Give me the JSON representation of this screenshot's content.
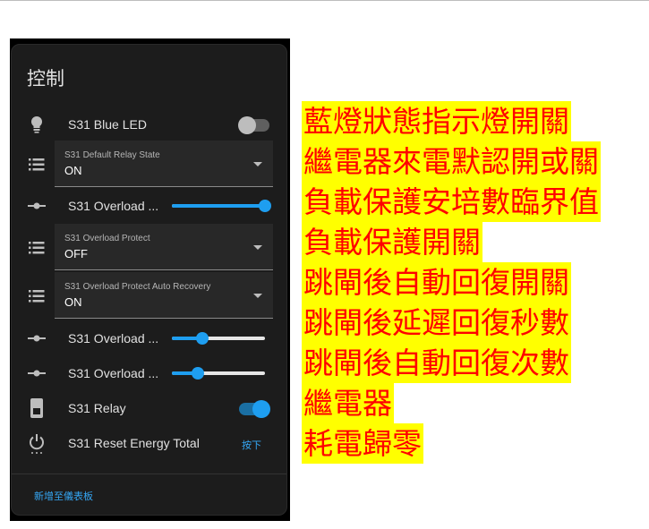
{
  "card": {
    "title": "控制",
    "add_link": "新增至儀表板",
    "rows": [
      {
        "icon": "lightbulb-icon",
        "label": "S31 Blue LED",
        "toggle": false
      },
      {
        "icon": "list-icon",
        "caption": "S31 Default Relay State",
        "value": "ON"
      },
      {
        "icon": "slider-icon",
        "label": "S31 Overload ...",
        "level": 1.0
      },
      {
        "icon": "list-icon",
        "caption": "S31 Overload Protect",
        "value": "OFF"
      },
      {
        "icon": "list-icon",
        "caption": "S31 Overload Protect Auto Recovery",
        "value": "ON"
      },
      {
        "icon": "slider-icon",
        "label": "S31 Overload ...",
        "level": 0.33
      },
      {
        "icon": "slider-icon",
        "label": "S31 Overload ...",
        "level": 0.28
      },
      {
        "icon": "switch-icon",
        "label": "S31 Relay",
        "toggle": true
      },
      {
        "icon": "power-icon",
        "label": "S31 Reset Energy Total",
        "button": "按下"
      }
    ],
    "accent_color": "#1e9ef0"
  },
  "notes": [
    "藍燈狀態指示燈開關",
    "繼電器來電默認開或關",
    "負載保護安培數臨界值",
    "負載保護開關",
    "跳閘後自動回復開關",
    "跳閘後延遲回復秒數",
    "跳閘後自動回復次數",
    "繼電器",
    "耗電歸零"
  ],
  "colors": {
    "note_text": "#ff0000",
    "note_highlight": "#ffff00"
  }
}
